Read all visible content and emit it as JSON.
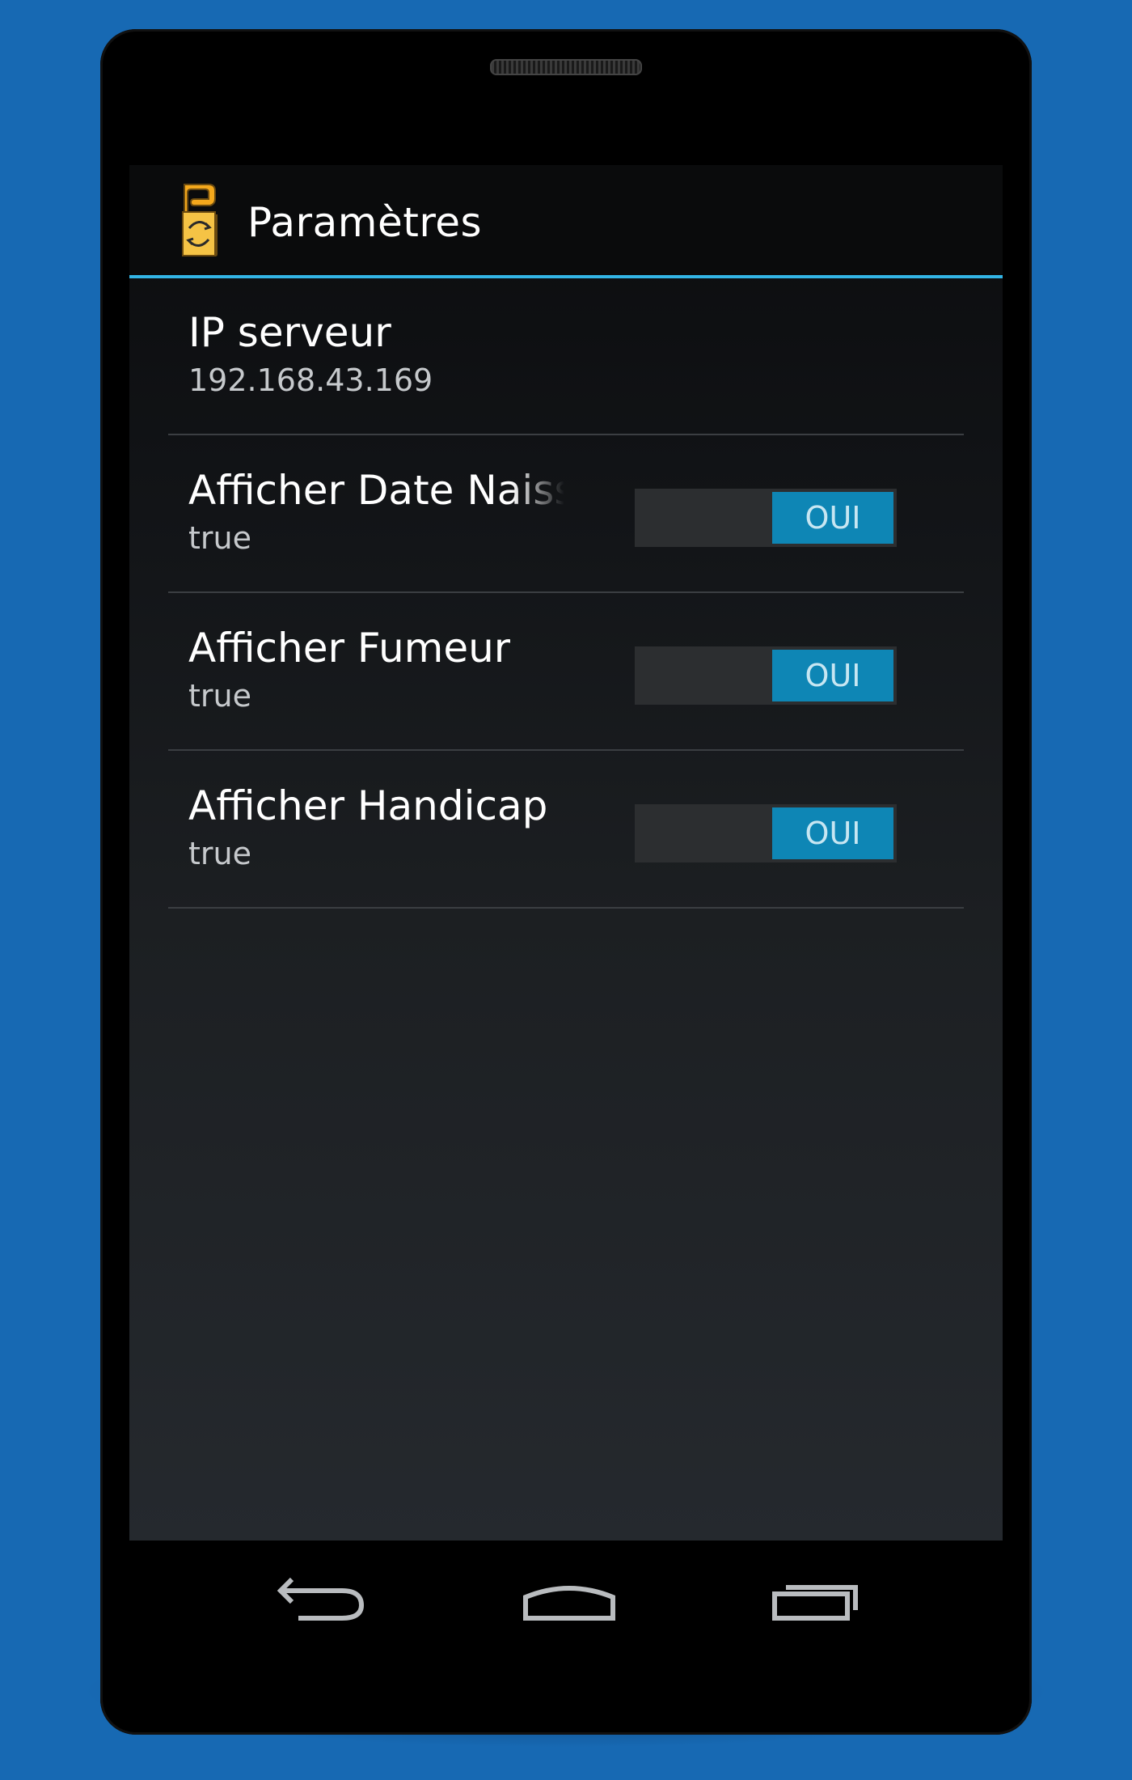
{
  "app": {
    "title": "Paramètres",
    "icon": "door-hanger-sync-icon"
  },
  "preferences": [
    {
      "title": "IP serveur",
      "summary": "192.168.43.169"
    },
    {
      "title": "Afficher Date Naissance",
      "summary": "true",
      "toggle_label": "OUI"
    },
    {
      "title": "Afficher Fumeur",
      "summary": "true",
      "toggle_label": "OUI"
    },
    {
      "title": "Afficher Handicap",
      "summary": "true",
      "toggle_label": "OUI"
    }
  ],
  "navigation": {
    "back_icon": "back-icon",
    "home_icon": "home-icon",
    "recents_icon": "recent-apps-icon"
  },
  "colors": {
    "background": "#1769b3",
    "accent": "#33b5e5",
    "toggle_on": "#0e86b5"
  }
}
